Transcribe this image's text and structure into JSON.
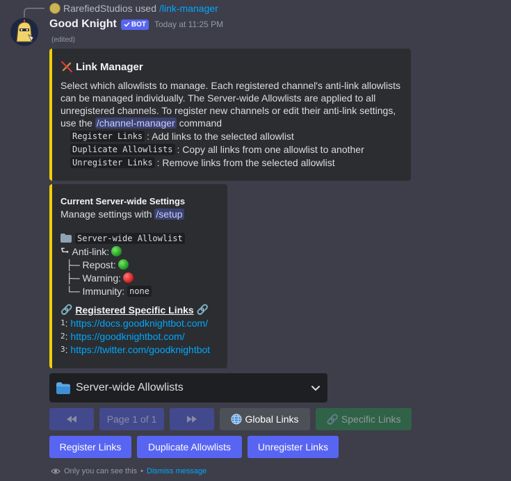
{
  "reply": {
    "user": "RarefiedStudios",
    "verb": "used",
    "command": "/link-manager"
  },
  "message": {
    "author": "Good Knight",
    "bot_tag": "BOT",
    "timestamp": "Today at 11:25 PM",
    "edited": "(edited)"
  },
  "embed1": {
    "title": "Link Manager",
    "description": "Select which allowlists to manage. Each registered channel's anti-link allowlists can be managed individually. The Server-wide Allowlists are applied to all unregistered channels. To register new channels or edit their anti-link settings, use the",
    "command_mention": "/channel-manager",
    "command_suffix": "command",
    "commands": [
      {
        "code": "Register Links",
        "desc": ": Add links to the selected allowlist"
      },
      {
        "code": "Duplicate Allowlists",
        "desc": ": Copy all links from one allowlist to another"
      },
      {
        "code": "Unregister Links",
        "desc": ": Remove links from the selected allowlist"
      }
    ]
  },
  "embed2": {
    "title": "Current Server-wide Settings",
    "subtitle_prefix": "Manage settings with",
    "subtitle_mention": "/setup",
    "allowlist_code": "Server-wide Allowlist",
    "anti_link_label": "Anti-link:",
    "repost_label": "Repost:",
    "warning_label": "Warning:",
    "immunity_label": "Immunity:",
    "immunity_value": "none",
    "specific_links_title": "Registered Specific Links",
    "links": [
      {
        "index": "1",
        "url": "https://docs.goodknightbot.com/"
      },
      {
        "index": "2",
        "url": "https://goodknightbot.com/"
      },
      {
        "index": "3",
        "url": "https://twitter.com/goodknightbot"
      }
    ]
  },
  "select_menu": {
    "label": "Server-wide Allowlists"
  },
  "buttons": {
    "page": "Page 1 of 1",
    "global_links": "Global Links",
    "specific_links": "Specific Links",
    "register_links": "Register Links",
    "duplicate_allowlists": "Duplicate Allowlists",
    "unregister_links": "Unregister Links"
  },
  "ephemeral": {
    "text": "Only you can see this",
    "separator": "•",
    "dismiss": "Dismiss message"
  },
  "colors": {
    "background": "#3d3e4a",
    "embed_bg": "#2b2d31",
    "embed_accent": "#f0d000",
    "blurple": "#5865f2",
    "link": "#00a8fc"
  }
}
